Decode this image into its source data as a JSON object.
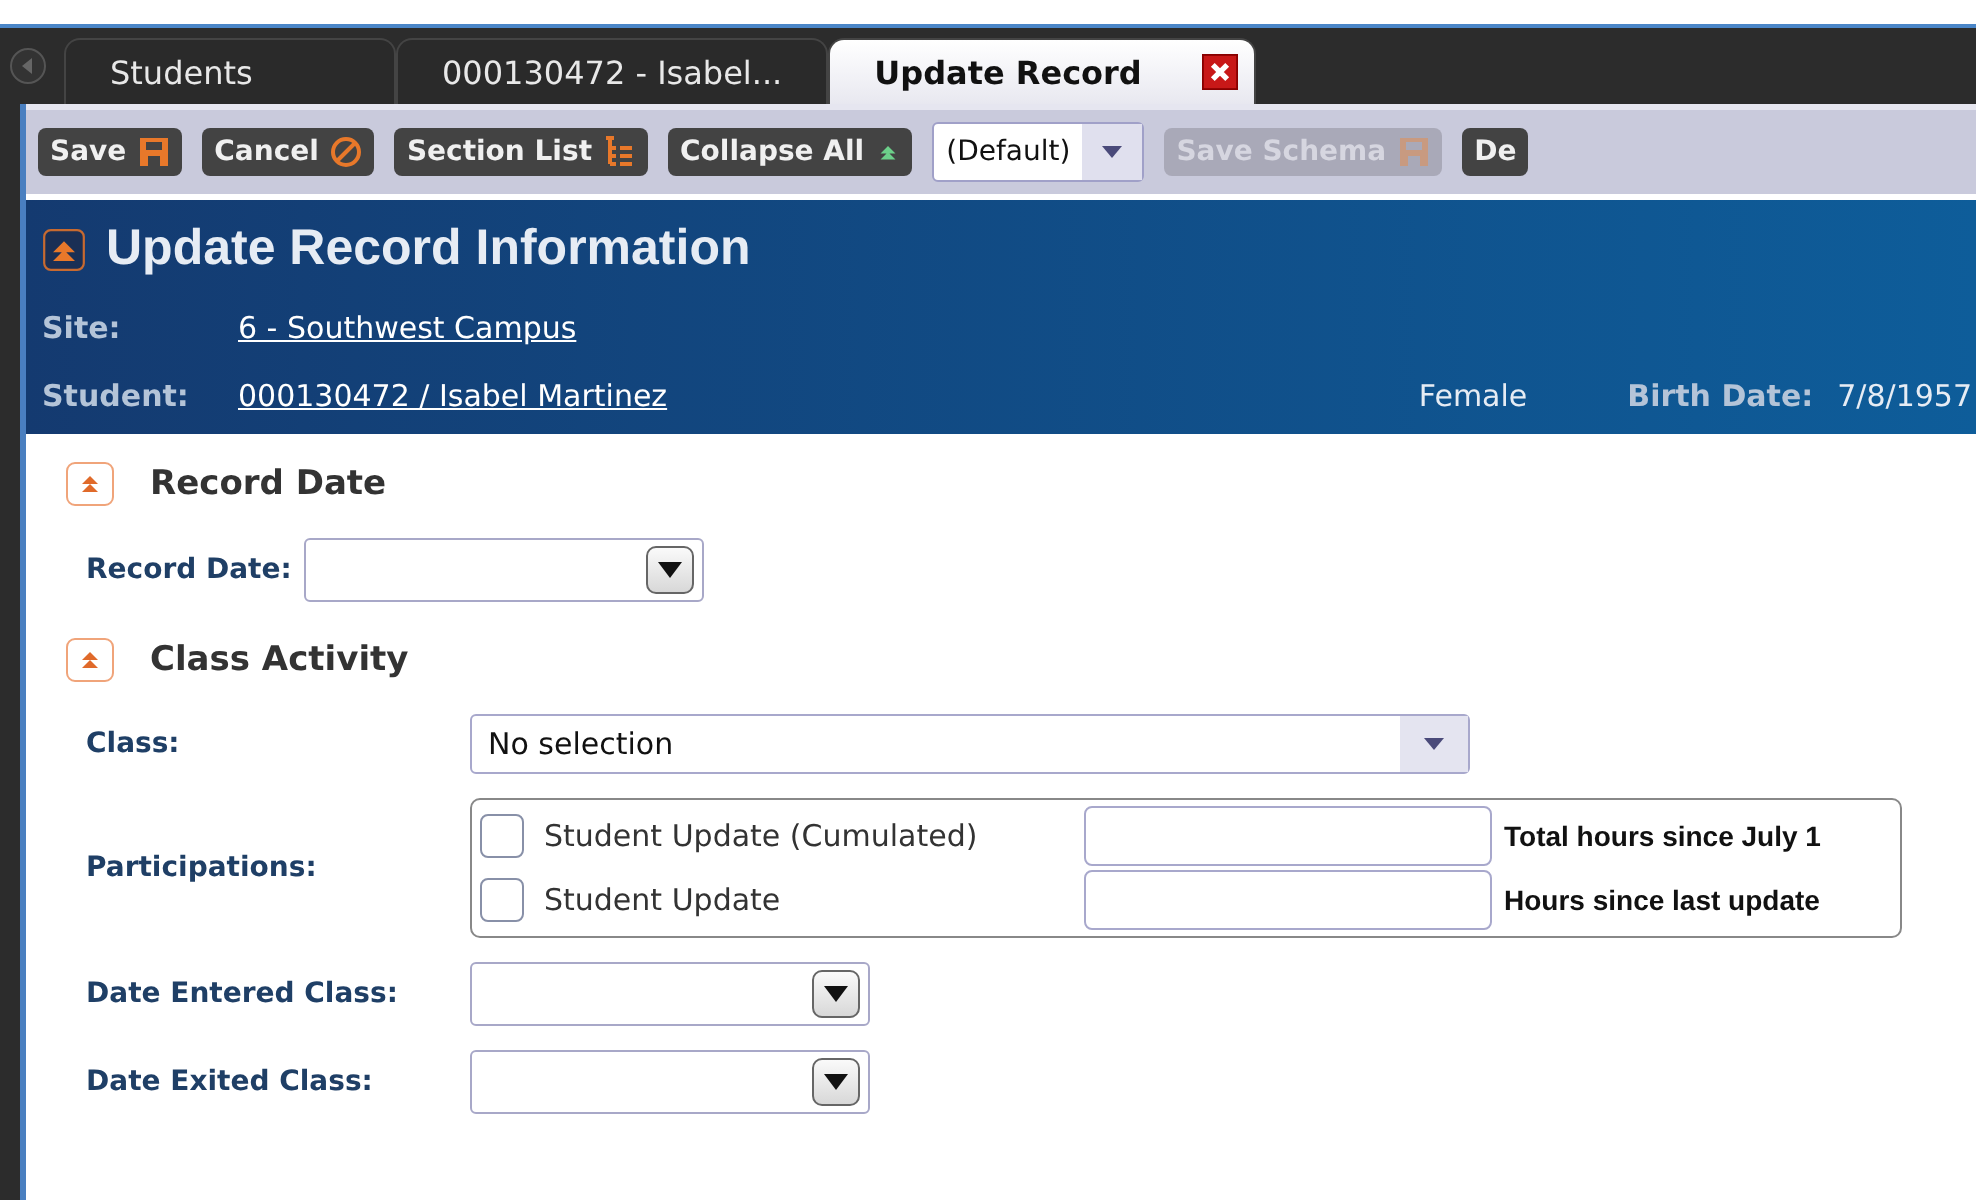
{
  "tabs": [
    {
      "label": "Students",
      "selected": false
    },
    {
      "label": "000130472 - Isabel...",
      "selected": false
    },
    {
      "label": "Update Record",
      "selected": true
    }
  ],
  "toolbar": [
    {
      "kind": "save",
      "label": "Save",
      "disabled": false
    },
    {
      "kind": "cancel",
      "label": "Cancel",
      "disabled": false
    },
    {
      "kind": "list",
      "label": "Section List",
      "disabled": false
    },
    {
      "kind": "collapse",
      "label": "Collapse All",
      "disabled": false
    },
    {
      "kind": "select",
      "value": "(Default)"
    },
    {
      "kind": "save",
      "label": "Save Schema",
      "disabled": true
    },
    {
      "kind": "plain",
      "label": "De",
      "disabled": false
    }
  ],
  "header": {
    "title": "Update Record Information",
    "expanded": true,
    "site_label": "Site:",
    "site": "6 - Southwest Campus",
    "student_label": "Student:",
    "student": "000130472 / Isabel Martinez",
    "gender": "Female",
    "birth_label": "Birth Date:",
    "birth_date": "7/8/1957"
  },
  "sections": [
    {
      "title": "Record Date",
      "expanded": true,
      "fields": [
        {
          "kind": "date",
          "label": "Record Date:"
        }
      ]
    },
    {
      "title": "Class Activity",
      "expanded": true,
      "fields": [
        {
          "kind": "select",
          "label": "Class:",
          "value": "No selection"
        },
        {
          "kind": "participations",
          "label": "Participations:",
          "options": [
            {
              "label": "Student Update (Cumulated)",
              "checked": false,
              "hours_label": "Total hours since July 1"
            },
            {
              "label": "Student Update",
              "checked": false,
              "hours_label": "Hours since last update"
            }
          ]
        },
        {
          "kind": "date",
          "label": "Date Entered Class:"
        },
        {
          "kind": "date",
          "label": "Date Exited Class:"
        }
      ]
    }
  ]
}
